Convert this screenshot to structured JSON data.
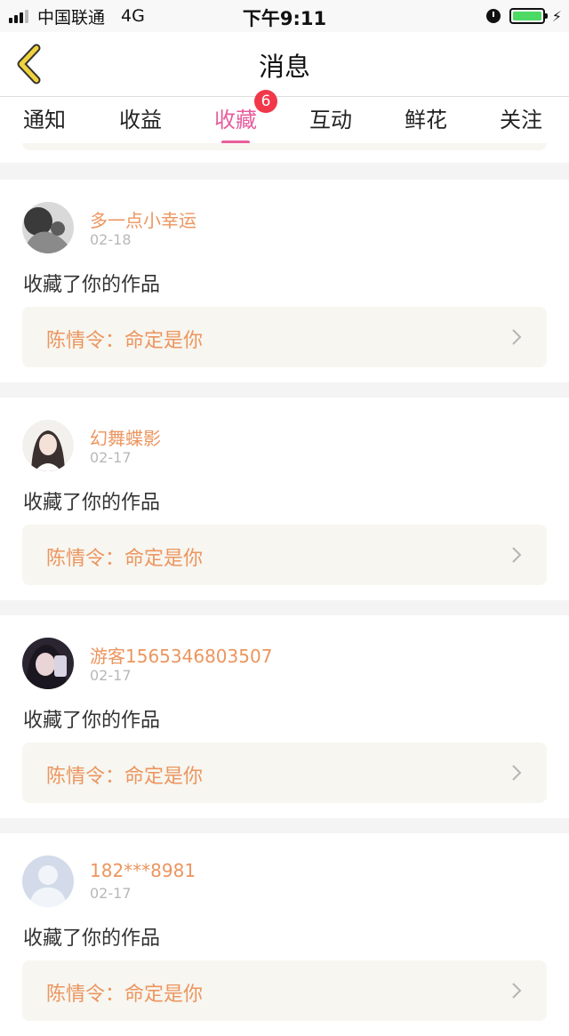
{
  "status_bar": {
    "carrier": "中国联通",
    "network": "4G",
    "time": "下午9:11",
    "battery_level": 1.0
  },
  "nav": {
    "back_icon": "chevron-left-icon",
    "title": "消息"
  },
  "tabs": [
    {
      "label": "通知",
      "active": false
    },
    {
      "label": "收益",
      "active": false
    },
    {
      "label": "收藏",
      "active": true,
      "badge": "6"
    },
    {
      "label": "互动",
      "active": false
    },
    {
      "label": "鲜花",
      "active": false
    },
    {
      "label": "关注",
      "active": false
    }
  ],
  "colors": {
    "accent": "#e85d9c",
    "badge": "#f0384a",
    "name_orange": "#ec955f",
    "work_box_bg": "#f7f6f0"
  },
  "messages": [
    {
      "user": "多一点小幸运",
      "date": "02-18",
      "text": "收藏了你的作品",
      "work": "陈情令：命定是你",
      "avatar": "photo-avatar-dark"
    },
    {
      "user": "幻舞蝶影",
      "date": "02-17",
      "text": "收藏了你的作品",
      "work": "陈情令：命定是你",
      "avatar": "photo-avatar-light"
    },
    {
      "user": "游客1565346803507",
      "date": "02-17",
      "text": "收藏了你的作品",
      "work": "陈情令：命定是你",
      "avatar": "photo-avatar-pink"
    },
    {
      "user": "182***8981",
      "date": "02-17",
      "text": "收藏了你的作品",
      "work": "陈情令：命定是你",
      "avatar": "default-avatar-icon"
    }
  ]
}
